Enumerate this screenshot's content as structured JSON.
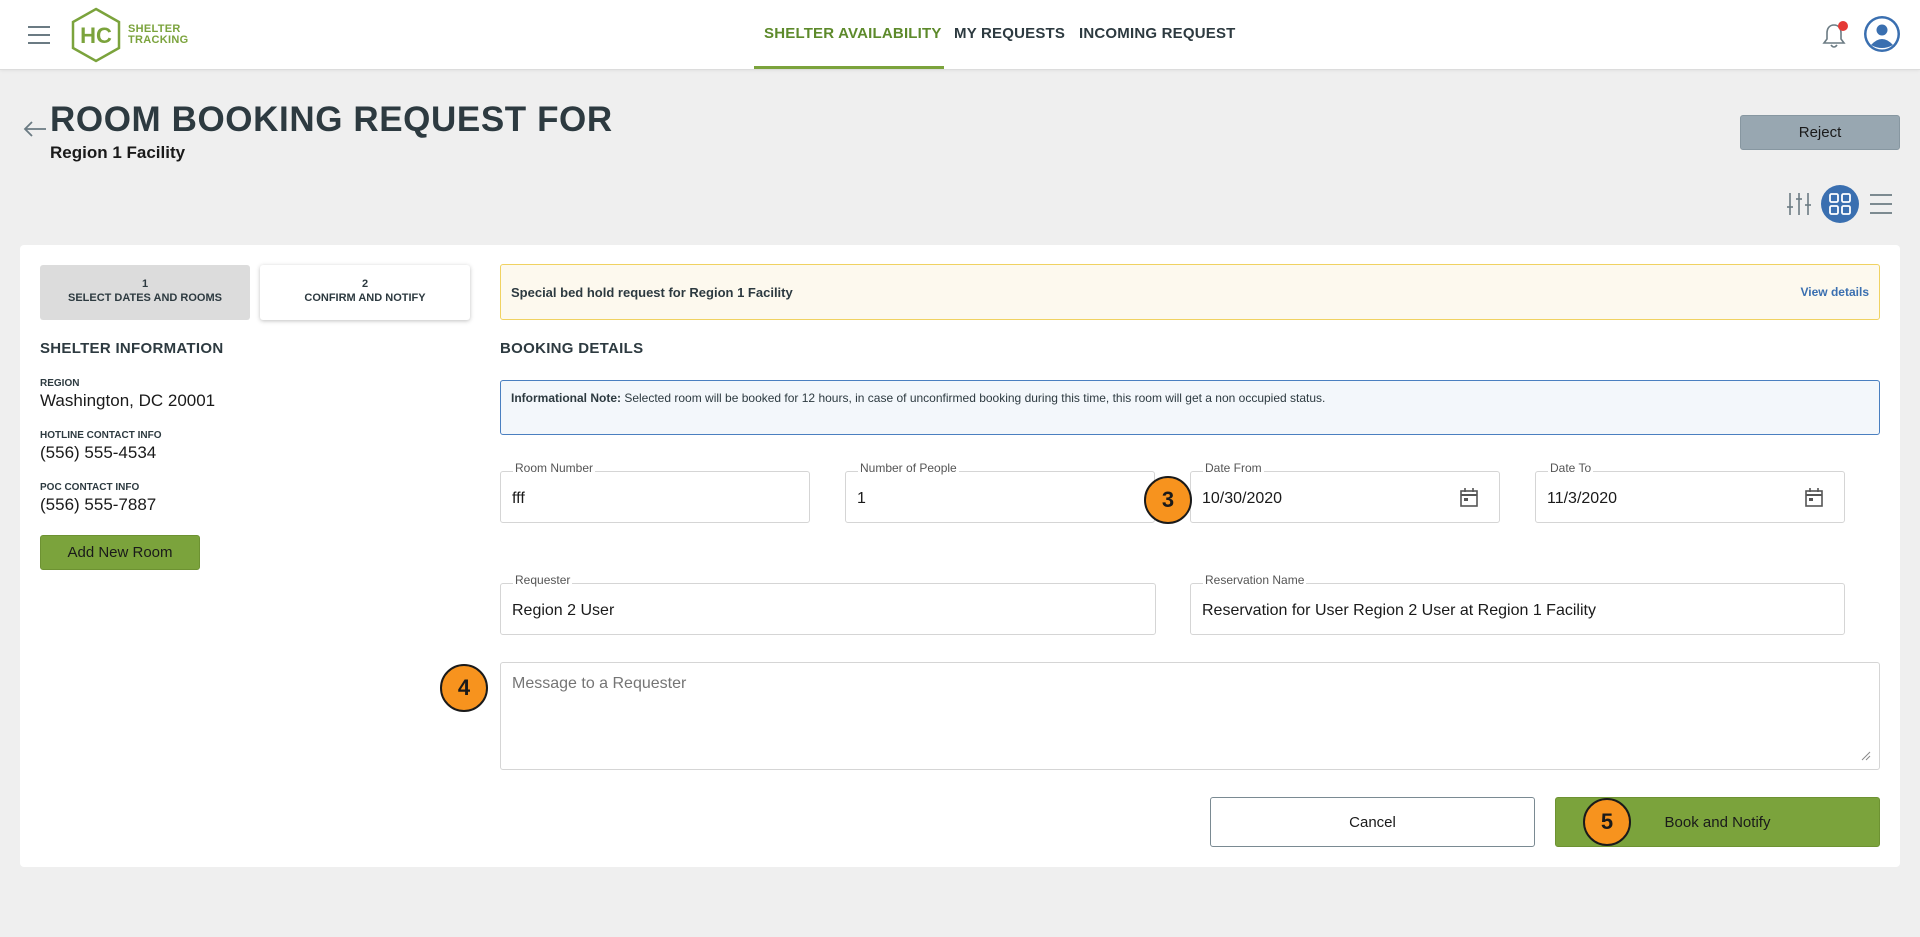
{
  "header": {
    "logo_mark": "HC",
    "logo_text_line1": "SHELTER",
    "logo_text_line2": "TRACKING",
    "nav": [
      {
        "label": "SHELTER AVAILABILITY",
        "active": true
      },
      {
        "label": "MY REQUESTS",
        "active": false
      },
      {
        "label": "INCOMING REQUEST",
        "active": false
      }
    ],
    "icons": {
      "menu": "hamburger-icon",
      "notifications": "bell-icon",
      "profile": "user-avatar-icon"
    },
    "accent_color": "#7ba33c"
  },
  "page": {
    "title": "ROOM BOOKING REQUEST FOR",
    "subtitle": "Region 1 Facility",
    "reject_label": "Reject"
  },
  "steps": [
    {
      "number": "1",
      "label": "SELECT DATES AND ROOMS",
      "active": false
    },
    {
      "number": "2",
      "label": "CONFIRM AND NOTIFY",
      "active": true
    }
  ],
  "shelter_info": {
    "title": "SHELTER INFORMATION",
    "region_label": "REGION",
    "region_value": "Washington, DC 20001",
    "hotline_label": "HOTLINE CONTACT INFO",
    "hotline_value": "(556) 555-4534",
    "poc_label": "POC CONTACT INFO",
    "poc_value": "(556) 555-7887",
    "add_room_label": "Add New Room"
  },
  "alert": {
    "text": "Special bed hold request for Region 1 Facility",
    "link": "View details"
  },
  "booking": {
    "title": "BOOKING DETAILS",
    "note_bold": "Informational Note:",
    "note_text": " Selected room will be booked for 12 hours, in case of unconfirmed booking during this time, this room will get a non occupied status.",
    "fields": {
      "room_number": {
        "label": "Room Number",
        "value": "fff"
      },
      "people": {
        "label": "Number of People",
        "value": "1"
      },
      "date_from": {
        "label": "Date From",
        "value": "10/30/2020"
      },
      "date_to": {
        "label": "Date To",
        "value": "11/3/2020"
      },
      "requester": {
        "label": "Requester",
        "value": "Region 2 User"
      },
      "reservation": {
        "label": "Reservation Name",
        "value": "Reservation for User Region 2 User at Region 1 Facility"
      }
    },
    "message_placeholder": "Message to a Requester",
    "cancel_label": "Cancel",
    "book_label": "Book and Notify"
  },
  "callouts": {
    "c3": "3",
    "c4": "4",
    "c5": "5",
    "color": "#f7931e"
  }
}
